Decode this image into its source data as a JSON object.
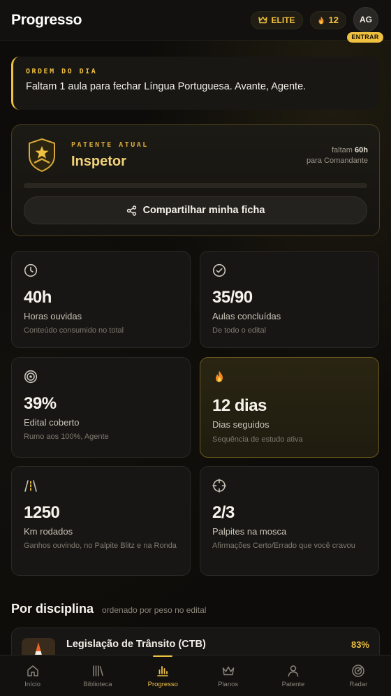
{
  "header": {
    "title": "Progresso",
    "elite_label": "ELITE",
    "streak_count": "12",
    "avatar_initials": "AG",
    "enter_label": "ENTRAR"
  },
  "order_of_day": {
    "kicker": "ORDEM DO DIA",
    "message": "Faltam 1 aula para fechar Língua Portuguesa. Avante, Agente."
  },
  "rank": {
    "kicker": "PATENTE ATUAL",
    "name": "Inspetor",
    "need_prefix": "faltam",
    "need_hours": "60h",
    "need_target": "para Comandante",
    "progress_fraction": 0,
    "share_label": "Compartilhar minha ficha"
  },
  "stats": [
    {
      "icon": "clock-icon",
      "value": "40h",
      "label": "Horas ouvidas",
      "sub": "Conteúdo consumido no total"
    },
    {
      "icon": "check-circle-icon",
      "value": "35/90",
      "label": "Aulas concluídas",
      "sub": "De todo o edital"
    },
    {
      "icon": "target-icon",
      "value": "39%",
      "label": "Edital coberto",
      "sub": "Rumo aos 100%, Agente"
    },
    {
      "icon": "flame-icon",
      "value": "12 dias",
      "label": "Dias seguidos",
      "sub": "Sequência de estudo ativa"
    },
    {
      "icon": "road-icon",
      "value": "1250",
      "label": "Km rodados",
      "sub": "Ganhos ouvindo, no Palpite Blitz e na Ronda"
    },
    {
      "icon": "crosshair-icon",
      "value": "2/3",
      "label": "Palpites na mosca",
      "sub": "Afirmações Certo/Errado que você cravou"
    }
  ],
  "disciplines": {
    "title": "Por disciplina",
    "subtitle": "ordenado por peso no edital",
    "items": [
      {
        "name": "Legislação de Trânsito (CTB)",
        "percent": "83%"
      }
    ]
  },
  "nav": [
    {
      "icon": "home-icon",
      "label": "Início"
    },
    {
      "icon": "library-icon",
      "label": "Biblioteca"
    },
    {
      "icon": "bar-chart-icon",
      "label": "Progresso",
      "active": true
    },
    {
      "icon": "crown-icon",
      "label": "Planos"
    },
    {
      "icon": "user-icon",
      "label": "Patente"
    },
    {
      "icon": "radar-icon",
      "label": "Radar"
    }
  ],
  "colors": {
    "accent": "#f0c040",
    "background": "#0d0c0a",
    "card": "#171614"
  }
}
